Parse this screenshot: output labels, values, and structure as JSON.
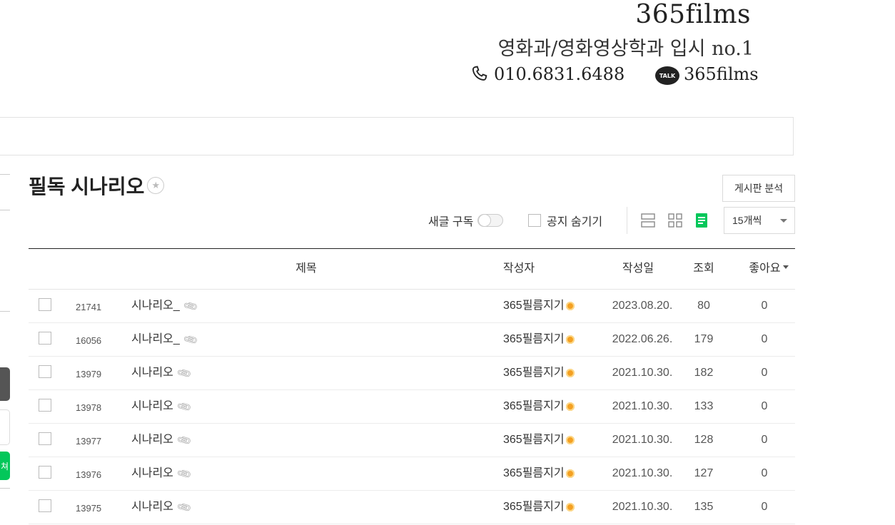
{
  "banner": {
    "brand": "365films",
    "tagline": "영화과/영화영상학과 입시 no.1",
    "phone": "010.6831.6488",
    "kakao_badge": "TALK",
    "kakao_id": "365films"
  },
  "sidebar": {
    "green_button_fragment": "쳐"
  },
  "board": {
    "title": "필독 시나리오",
    "analysis_button": "게시판 분석",
    "subscribe_label": "새글 구독",
    "hide_notice_label": "공지 숨기기",
    "per_page": "15개씩",
    "view_modes": [
      "list-view-icon",
      "card-view-icon",
      "blog-view-icon"
    ],
    "active_view_color": "#03c75a"
  },
  "table": {
    "columns": {
      "title": "제목",
      "author": "작성자",
      "date": "작성일",
      "views": "조회",
      "likes": "좋아요"
    },
    "rows": [
      {
        "num": "21741",
        "title": "시나리오_",
        "author": "365필름지기",
        "date": "2023.08.20.",
        "views": "80",
        "likes": "0"
      },
      {
        "num": "16056",
        "title": "시나리오_",
        "author": "365필름지기",
        "date": "2022.06.26.",
        "views": "179",
        "likes": "0"
      },
      {
        "num": "13979",
        "title": "시나리오",
        "author": "365필름지기",
        "date": "2021.10.30.",
        "views": "182",
        "likes": "0"
      },
      {
        "num": "13978",
        "title": "시나리오",
        "author": "365필름지기",
        "date": "2021.10.30.",
        "views": "133",
        "likes": "0"
      },
      {
        "num": "13977",
        "title": "시나리오",
        "author": "365필름지기",
        "date": "2021.10.30.",
        "views": "128",
        "likes": "0"
      },
      {
        "num": "13976",
        "title": "시나리오",
        "author": "365필름지기",
        "date": "2021.10.30.",
        "views": "127",
        "likes": "0"
      },
      {
        "num": "13975",
        "title": "시나리오",
        "author": "365필름지기",
        "date": "2021.10.30.",
        "views": "135",
        "likes": "0"
      }
    ]
  }
}
